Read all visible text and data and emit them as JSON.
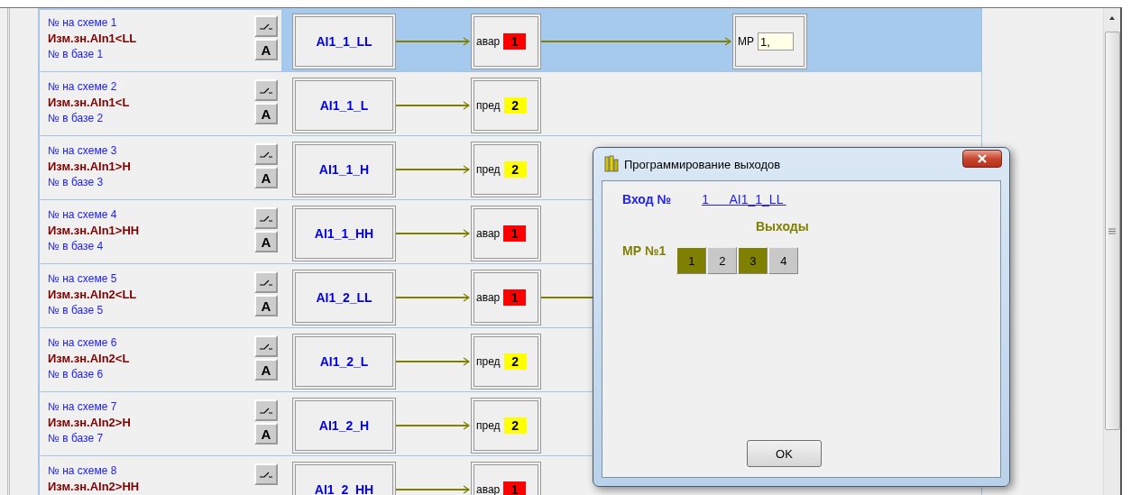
{
  "rows": [
    {
      "scheme_no": "№ на схеме 1",
      "measure": "Изм.зн.AIn1<LL",
      "base_no": "№ в базе 1",
      "mode_button": "A",
      "selected": true,
      "name": "AI1_1_LL",
      "status": {
        "label": "авар",
        "number": "1",
        "color": "#ff0000"
      },
      "continues": true,
      "output": {
        "label": "МР",
        "value": "1,"
      }
    },
    {
      "scheme_no": "№ на схеме 2",
      "measure": "Изм.зн.AIn1<L",
      "base_no": "№ в базе 2",
      "mode_button": "A",
      "selected": false,
      "name": "AI1_1_L",
      "status": {
        "label": "пред",
        "number": "2",
        "color": "#ffff00"
      },
      "continues": false
    },
    {
      "scheme_no": "№ на схеме 3",
      "measure": "Изм.зн.AIn1>H",
      "base_no": "№ в базе 3",
      "mode_button": "A",
      "selected": false,
      "name": "AI1_1_H",
      "status": {
        "label": "пред",
        "number": "2",
        "color": "#ffff00"
      },
      "continues": false
    },
    {
      "scheme_no": "№ на схеме 4",
      "measure": "Изм.зн.AIn1>HH",
      "base_no": "№ в базе 4",
      "mode_button": "A",
      "selected": false,
      "name": "AI1_1_HH",
      "status": {
        "label": "авар",
        "number": "1",
        "color": "#ff0000"
      },
      "continues": false
    },
    {
      "scheme_no": "№ на схеме 5",
      "measure": "Изм.зн.AIn2<LL",
      "base_no": "№ в базе 5",
      "mode_button": "A",
      "selected": false,
      "name": "AI1_2_LL",
      "status": {
        "label": "авар",
        "number": "1",
        "color": "#ff0000"
      },
      "continues": true
    },
    {
      "scheme_no": "№ на схеме 6",
      "measure": "Изм.зн.AIn2<L",
      "base_no": "№ в базе 6",
      "mode_button": "A",
      "selected": false,
      "name": "AI1_2_L",
      "status": {
        "label": "пред",
        "number": "2",
        "color": "#ffff00"
      },
      "continues": false
    },
    {
      "scheme_no": "№ на схеме 7",
      "measure": "Изм.зн.AIn2>H",
      "base_no": "№ в базе 7",
      "mode_button": "A",
      "selected": false,
      "name": "AI1_2_H",
      "status": {
        "label": "пред",
        "number": "2",
        "color": "#ffff00"
      },
      "continues": false
    },
    {
      "scheme_no": "№ на схеме 8",
      "measure": "Изм.зн.AIn2>HH",
      "selected": false,
      "name": "AI1_2_HH",
      "status": {
        "label": "авар",
        "number": "1",
        "color": "#ff0000"
      },
      "continues": false
    }
  ],
  "dialog": {
    "title": "Программирование выходов",
    "input_label": "Вход №",
    "input_link": "1      AI1_1_LL ",
    "outputs_title": "Выходы",
    "relay_label": "МР №1",
    "outputs": [
      {
        "label": "1",
        "selected": true
      },
      {
        "label": "2",
        "selected": false
      },
      {
        "label": "3",
        "selected": true
      },
      {
        "label": "4",
        "selected": false
      }
    ],
    "ok_button": "OK"
  }
}
